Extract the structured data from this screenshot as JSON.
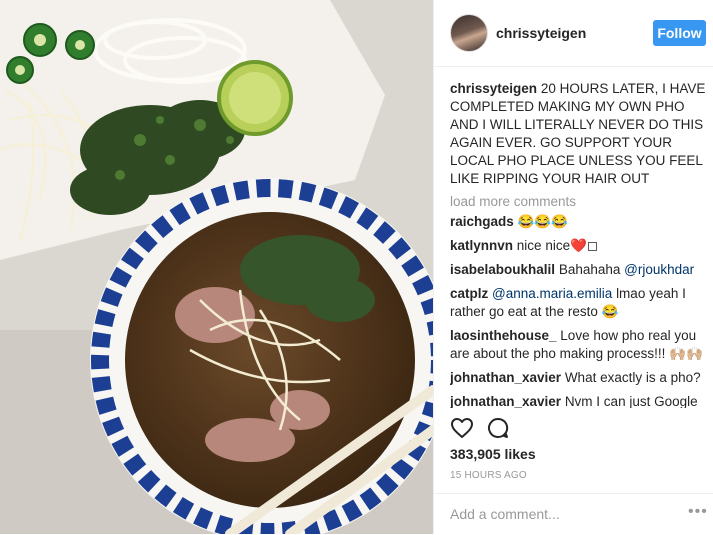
{
  "post": {
    "username": "chrissyteigen",
    "follow_label": "Follow",
    "caption_user": "chrissyteigen",
    "caption_text": "20 HOURS LATER, I HAVE COMPLETED MAKING MY OWN PHO AND I WILL LITERALLY NEVER DO THIS AGAIN EVER. GO SUPPORT YOUR LOCAL PHO PLACE UNLESS YOU FEEL LIKE RIPPING YOUR HAIR OUT",
    "load_more": "load more comments",
    "comments": [
      {
        "user": "raichgads",
        "text": "😂😂😂",
        "mention": ""
      },
      {
        "user": "katlynnvn",
        "text": "nice nice❤️◻",
        "mention": ""
      },
      {
        "user": "isabelaboukhalil",
        "text": "Bahahaha",
        "mention": "@rjoukhdar"
      },
      {
        "user": "catplz",
        "text": "lmao yeah I rather go eat at the resto 😂",
        "mention": "@anna.maria.emilia"
      },
      {
        "user": "laosinthehouse_",
        "text": "Love how pho real you are about the pho making process!!! 🙌🏼🙌🏼",
        "mention": ""
      },
      {
        "user": "johnathan_xavier",
        "text": "What exactly is a pho?",
        "mention": ""
      },
      {
        "user": "johnathan_xavier",
        "text": "Nvm I can just Google",
        "mention": ""
      }
    ],
    "likes": "383,905 likes",
    "timestamp": "15 HOURS AGO",
    "comment_placeholder": "Add a comment...",
    "more_label": "•••"
  },
  "icons": {
    "like": "heart-icon",
    "comment": "comment-bubble-icon",
    "options": "more-options-icon"
  },
  "colors": {
    "follow_button": "#3897f0",
    "mention": "#003569",
    "muted": "#999999"
  }
}
